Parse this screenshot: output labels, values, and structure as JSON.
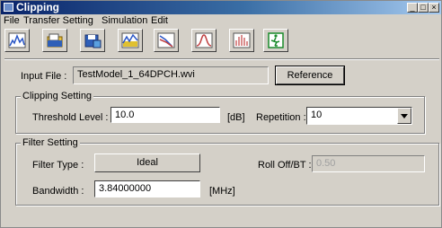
{
  "window": {
    "title": "Clipping",
    "minimize_glyph": "_",
    "maximize_glyph": "□",
    "close_glyph": "×"
  },
  "menu": [
    {
      "label": "File"
    },
    {
      "label": "Transfer Setting"
    },
    {
      "label": "Simulation"
    },
    {
      "label": "Edit"
    }
  ],
  "toolbar": {
    "buttons": [
      {
        "icon": "spectrum-chart-icon"
      },
      {
        "icon": "open-folder-icon"
      },
      {
        "icon": "save-file-icon"
      },
      {
        "icon": "waveform-graph-icon"
      },
      {
        "icon": "spectrum-analyzer-icon"
      },
      {
        "icon": "bell-curve-icon"
      },
      {
        "icon": "bar-spectrum-icon"
      },
      {
        "icon": "exit-icon"
      }
    ]
  },
  "input_file": {
    "label": "Input File :",
    "value": "TestModel_1_64DPCH.wvi",
    "reference_button": "Reference"
  },
  "clipping_setting": {
    "group_title": "Clipping Setting",
    "threshold_label": "Threshold Level :",
    "threshold_value": "10.0",
    "threshold_unit": "[dB]",
    "repetition_label": "Repetition :",
    "repetition_value": "10"
  },
  "filter_setting": {
    "group_title": "Filter Setting",
    "filter_type_label": "Filter Type :",
    "filter_type_button": "Ideal",
    "rolloff_label": "Roll Off/BT :",
    "rolloff_value": "0.50",
    "bandwidth_label": "Bandwidth :",
    "bandwidth_value": "3.84000000",
    "bandwidth_unit": "[MHz]"
  }
}
